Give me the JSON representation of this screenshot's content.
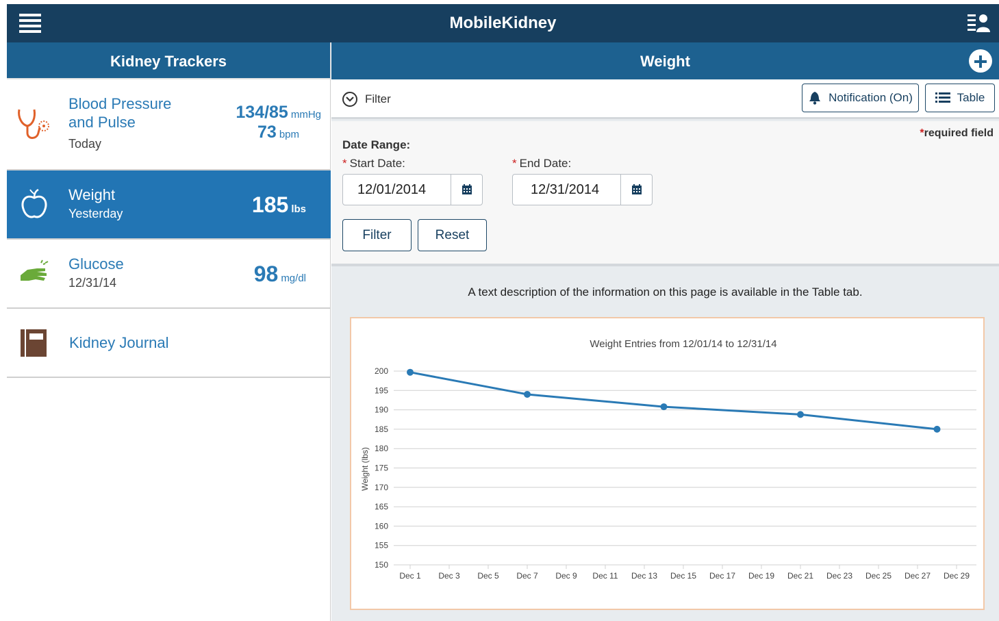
{
  "app": {
    "title": "MobileKidney"
  },
  "sidebar": {
    "title": "Kidney Trackers",
    "items": [
      {
        "name": "Blood Pressure and Pulse",
        "name_line1": "Blood Pressure",
        "name_line2": "and Pulse",
        "sub": "Today",
        "value1": "134/85",
        "unit1": "mmHg",
        "value2": "73",
        "unit2": "bpm"
      },
      {
        "name": "Weight",
        "sub": "Yesterday",
        "value": "185",
        "unit": "lbs",
        "active": true
      },
      {
        "name": "Glucose",
        "sub": "12/31/14",
        "value": "98",
        "unit": "mg/dl"
      },
      {
        "name": "Kidney Journal"
      }
    ]
  },
  "main": {
    "title": "Weight",
    "filter_label": "Filter",
    "notification_label": "Notification (On)",
    "table_label": "Table",
    "required_mark": "*",
    "required_note": "required field",
    "date_range_label": "Date Range:",
    "start_label": "Start Date:",
    "start_value": "12/01/2014",
    "end_label": "End Date:",
    "end_value": "12/31/2014",
    "filter_button": "Filter",
    "reset_button": "Reset",
    "description": "A text description of the information on this page is available in the Table tab."
  },
  "colors": {
    "header": "#173f5f",
    "subheader": "#1d6190",
    "accent": "#2275b4",
    "line": "#2a7ab5"
  },
  "chart_data": {
    "type": "line",
    "title": "Weight Entries from 12/01/14 to 12/31/14",
    "xlabel": "",
    "ylabel": "Weight (lbs)",
    "ylim": [
      150,
      200
    ],
    "yticks": [
      150,
      155,
      160,
      165,
      170,
      175,
      180,
      185,
      190,
      195,
      200
    ],
    "xlim": [
      1,
      29
    ],
    "xticks": [
      1,
      3,
      5,
      7,
      9,
      11,
      13,
      15,
      17,
      19,
      21,
      23,
      25,
      27,
      29
    ],
    "xtick_labels": [
      "Dec 1",
      "Dec 3",
      "Dec 5",
      "Dec 7",
      "Dec 9",
      "Dec 11",
      "Dec 13",
      "Dec 15",
      "Dec 17",
      "Dec 19",
      "Dec 21",
      "Dec 23",
      "Dec 25",
      "Dec 27",
      "Dec 29"
    ],
    "series": [
      {
        "x": [
          1,
          7,
          14,
          21,
          28
        ],
        "y": [
          199.7,
          194.0,
          190.8,
          188.8,
          185.0
        ]
      }
    ],
    "grid": true
  }
}
